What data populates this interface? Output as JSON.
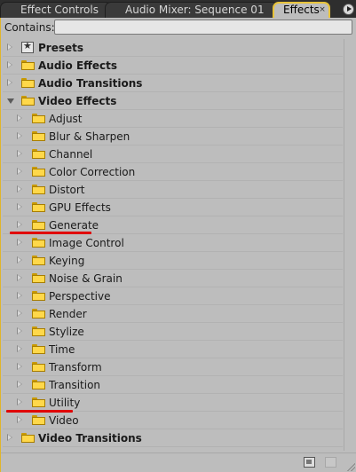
{
  "tabs": [
    {
      "label": "Effect Controls",
      "active": false
    },
    {
      "label": "Audio Mixer: Sequence 01",
      "active": false
    },
    {
      "label": "Effects",
      "active": true
    }
  ],
  "search": {
    "label": "Contains:",
    "value": "",
    "placeholder": ""
  },
  "tree": [
    {
      "label": "Presets",
      "level": 0,
      "state": "collapsed",
      "icon": "presets-icon",
      "bold": true
    },
    {
      "label": "Audio Effects",
      "level": 0,
      "state": "collapsed",
      "icon": "folder-icon",
      "bold": true
    },
    {
      "label": "Audio Transitions",
      "level": 0,
      "state": "collapsed",
      "icon": "folder-icon",
      "bold": true
    },
    {
      "label": "Video Effects",
      "level": 0,
      "state": "expanded",
      "icon": "folder-icon",
      "bold": true
    },
    {
      "label": "Adjust",
      "level": 1,
      "state": "collapsed",
      "icon": "folder-icon",
      "bold": false
    },
    {
      "label": "Blur & Sharpen",
      "level": 1,
      "state": "collapsed",
      "icon": "folder-icon",
      "bold": false
    },
    {
      "label": "Channel",
      "level": 1,
      "state": "collapsed",
      "icon": "folder-icon",
      "bold": false
    },
    {
      "label": "Color Correction",
      "level": 1,
      "state": "collapsed",
      "icon": "folder-icon",
      "bold": false
    },
    {
      "label": "Distort",
      "level": 1,
      "state": "collapsed",
      "icon": "folder-icon",
      "bold": false
    },
    {
      "label": "GPU Effects",
      "level": 1,
      "state": "collapsed",
      "icon": "folder-icon",
      "bold": false
    },
    {
      "label": "Generate",
      "level": 1,
      "state": "collapsed",
      "icon": "folder-icon",
      "bold": false,
      "annotated": true
    },
    {
      "label": "Image Control",
      "level": 1,
      "state": "collapsed",
      "icon": "folder-icon",
      "bold": false
    },
    {
      "label": "Keying",
      "level": 1,
      "state": "collapsed",
      "icon": "folder-icon",
      "bold": false
    },
    {
      "label": "Noise & Grain",
      "level": 1,
      "state": "collapsed",
      "icon": "folder-icon",
      "bold": false
    },
    {
      "label": "Perspective",
      "level": 1,
      "state": "collapsed",
      "icon": "folder-icon",
      "bold": false
    },
    {
      "label": "Render",
      "level": 1,
      "state": "collapsed",
      "icon": "folder-icon",
      "bold": false
    },
    {
      "label": "Stylize",
      "level": 1,
      "state": "collapsed",
      "icon": "folder-icon",
      "bold": false
    },
    {
      "label": "Time",
      "level": 1,
      "state": "collapsed",
      "icon": "folder-icon",
      "bold": false
    },
    {
      "label": "Transform",
      "level": 1,
      "state": "collapsed",
      "icon": "folder-icon",
      "bold": false
    },
    {
      "label": "Transition",
      "level": 1,
      "state": "collapsed",
      "icon": "folder-icon",
      "bold": false
    },
    {
      "label": "Utility",
      "level": 1,
      "state": "collapsed",
      "icon": "folder-icon",
      "bold": false,
      "annotated": true
    },
    {
      "label": "Video",
      "level": 1,
      "state": "collapsed",
      "icon": "folder-icon",
      "bold": false
    },
    {
      "label": "Video Transitions",
      "level": 0,
      "state": "collapsed",
      "icon": "folder-icon",
      "bold": true
    }
  ],
  "colors": {
    "active_tab_outline": "#e8c33a",
    "panel_bg": "#bdbdbd",
    "folder": "#ffd84a",
    "annotation": "#e00000"
  },
  "footer": {
    "icons": [
      "new-bin-icon",
      "trash-icon"
    ]
  }
}
